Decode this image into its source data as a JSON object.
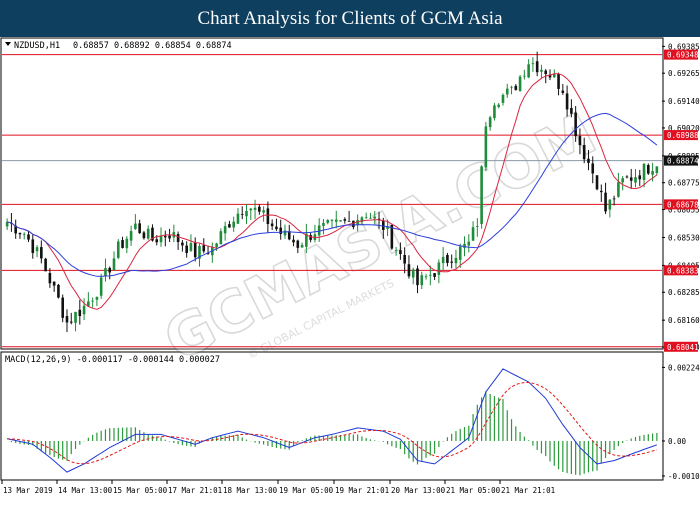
{
  "header": {
    "title": "Chart Analysis for Clients of GCM Asia"
  },
  "watermark": {
    "text": "GCMASIA.COM",
    "subtext": "© GLOBAL CAPITAL MARKETS"
  },
  "colors": {
    "bull": "#1e8c3a",
    "bear": "#111111",
    "ma_fast": "#d9263f",
    "ma_slow": "#2b3fdc",
    "level": "#e01020",
    "macd_hist": "#2a9a3a",
    "macd_line": "#1f3ad6",
    "macd_signal": "#e01818",
    "badge": "#e01020",
    "current_badge": "#111111"
  },
  "chart_data": [
    {
      "type": "candlestick",
      "title": "NZDUSD,H1",
      "ohlc_label": "0.68857 0.68892 0.68854 0.68874",
      "ylim": [
        0.6804,
        0.694
      ],
      "y_ticks": [
        "0.69385",
        "0.69265",
        "0.69140",
        "0.69020",
        "0.68895",
        "0.68775",
        "0.68655",
        "0.68530",
        "0.68405",
        "0.68285",
        "0.68160",
        "0.68040"
      ],
      "x_labels": [
        "13 Mar 2019",
        "14 Mar 13:00",
        "15 Mar 05:00",
        "17 Mar 21:01",
        "18 Mar 13:00",
        "19 Mar 05:00",
        "19 Mar 21:01",
        "20 Mar 13:00",
        "21 Mar 05:00",
        "21 Mar 21:01"
      ],
      "levels": [
        {
          "value": 0.69348,
          "label": "0.69348"
        },
        {
          "value": 0.68988,
          "label": "0.68988"
        },
        {
          "value": 0.68678,
          "label": "0.68678"
        },
        {
          "value": 0.68383,
          "label": "0.68383"
        },
        {
          "value": 0.68041,
          "label": "0.68041"
        }
      ],
      "current_price": {
        "value": 0.68874,
        "label": "0.68874"
      },
      "close_anchors": [
        [
          0,
          0.686
        ],
        [
          4,
          0.6855
        ],
        [
          8,
          0.6843
        ],
        [
          12,
          0.6825
        ],
        [
          14,
          0.6815
        ],
        [
          18,
          0.6822
        ],
        [
          22,
          0.6832
        ],
        [
          26,
          0.6848
        ],
        [
          30,
          0.6858
        ],
        [
          34,
          0.6852
        ],
        [
          38,
          0.6855
        ],
        [
          44,
          0.6846
        ],
        [
          48,
          0.6848
        ],
        [
          52,
          0.686
        ],
        [
          56,
          0.6868
        ],
        [
          60,
          0.6862
        ],
        [
          64,
          0.6855
        ],
        [
          68,
          0.685
        ],
        [
          72,
          0.6856
        ],
        [
          76,
          0.6858
        ],
        [
          80,
          0.686
        ],
        [
          84,
          0.6864
        ],
        [
          88,
          0.6858
        ],
        [
          92,
          0.6845
        ],
        [
          96,
          0.6832
        ],
        [
          100,
          0.6838
        ],
        [
          104,
          0.6845
        ],
        [
          108,
          0.685
        ],
        [
          110,
          0.686
        ],
        [
          112,
          0.6905
        ],
        [
          114,
          0.6915
        ],
        [
          118,
          0.6918
        ],
        [
          122,
          0.6932
        ],
        [
          126,
          0.6928
        ],
        [
          130,
          0.692
        ],
        [
          134,
          0.6895
        ],
        [
          138,
          0.6878
        ],
        [
          140,
          0.6865
        ],
        [
          144,
          0.6878
        ],
        [
          148,
          0.6882
        ],
        [
          152,
          0.6887
        ]
      ],
      "sma_fast_period": 10,
      "sma_slow_period": 30
    },
    {
      "type": "macd",
      "title": "MACD(12,26,9) -0.000117 -0.000144 0.000027",
      "ylim": [
        -0.0011,
        0.00232
      ],
      "y_ticks": [
        "0.002247",
        "0.00",
        "-0.00107"
      ],
      "macd_anchors": [
        [
          0,
          7e-05
        ],
        [
          6,
          -0.0001
        ],
        [
          10,
          -0.0005
        ],
        [
          14,
          -0.00095
        ],
        [
          18,
          -0.0007
        ],
        [
          24,
          -0.0002
        ],
        [
          30,
          0.0002
        ],
        [
          36,
          0.0002
        ],
        [
          44,
          -0.0001
        ],
        [
          48,
          0.0001
        ],
        [
          54,
          0.0003
        ],
        [
          60,
          0.0001
        ],
        [
          66,
          -0.0002
        ],
        [
          72,
          0.0001
        ],
        [
          76,
          0.0002
        ],
        [
          82,
          0.0004
        ],
        [
          88,
          0.0003
        ],
        [
          92,
          5e-05
        ],
        [
          96,
          -0.0006
        ],
        [
          100,
          -0.0007
        ],
        [
          104,
          -0.0003
        ],
        [
          108,
          0.0001
        ],
        [
          112,
          0.0015
        ],
        [
          116,
          0.0022
        ],
        [
          122,
          0.0018
        ],
        [
          126,
          0.0013
        ],
        [
          130,
          0.0005
        ],
        [
          134,
          -0.0002
        ],
        [
          138,
          -0.0007
        ],
        [
          142,
          -0.0006
        ],
        [
          146,
          -0.0004
        ],
        [
          152,
          -0.000117
        ]
      ]
    }
  ]
}
